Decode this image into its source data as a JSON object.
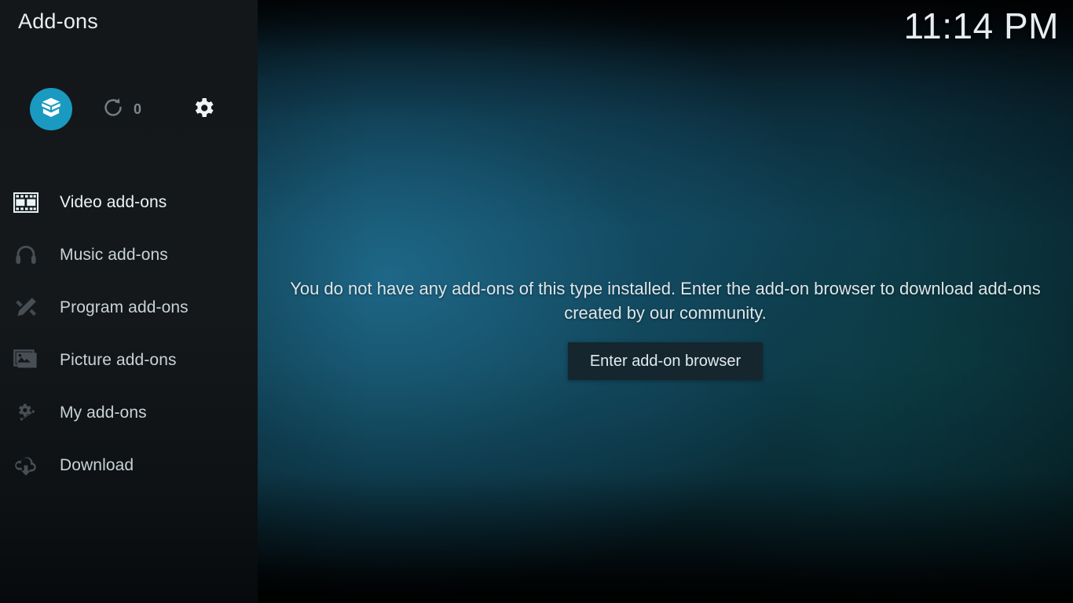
{
  "window": {
    "title": "Add-ons",
    "clock": "11:14 PM"
  },
  "sidebar": {
    "toolbar": {
      "addon_box": {
        "icon": "addon-box-icon",
        "label": "Add-ons"
      },
      "updates": {
        "icon": "refresh-icon",
        "count": "0"
      },
      "settings": {
        "icon": "gear-icon"
      }
    },
    "items": [
      {
        "label": "Video add-ons",
        "icon": "film-strip-icon",
        "active": true
      },
      {
        "label": "Music add-ons",
        "icon": "headphones-icon",
        "active": false
      },
      {
        "label": "Program add-ons",
        "icon": "pencil-ruler-icon",
        "active": false
      },
      {
        "label": "Picture add-ons",
        "icon": "picture-icon",
        "active": false
      },
      {
        "label": "My add-ons",
        "icon": "gear-wrench-icon",
        "active": false
      },
      {
        "label": "Download",
        "icon": "cloud-download-icon",
        "active": false
      }
    ]
  },
  "main": {
    "empty_message": "You do not have any add-ons of this type installed. Enter the add-on browser to download add-ons created by our community.",
    "enter_browser_label": "Enter add-on browser"
  },
  "colors": {
    "accent": "#1a9ac0",
    "sidebar_bg": "#14181b",
    "button_bg": "#15262f",
    "text_primary": "#e9edef",
    "icon_dim": "#474f55"
  }
}
